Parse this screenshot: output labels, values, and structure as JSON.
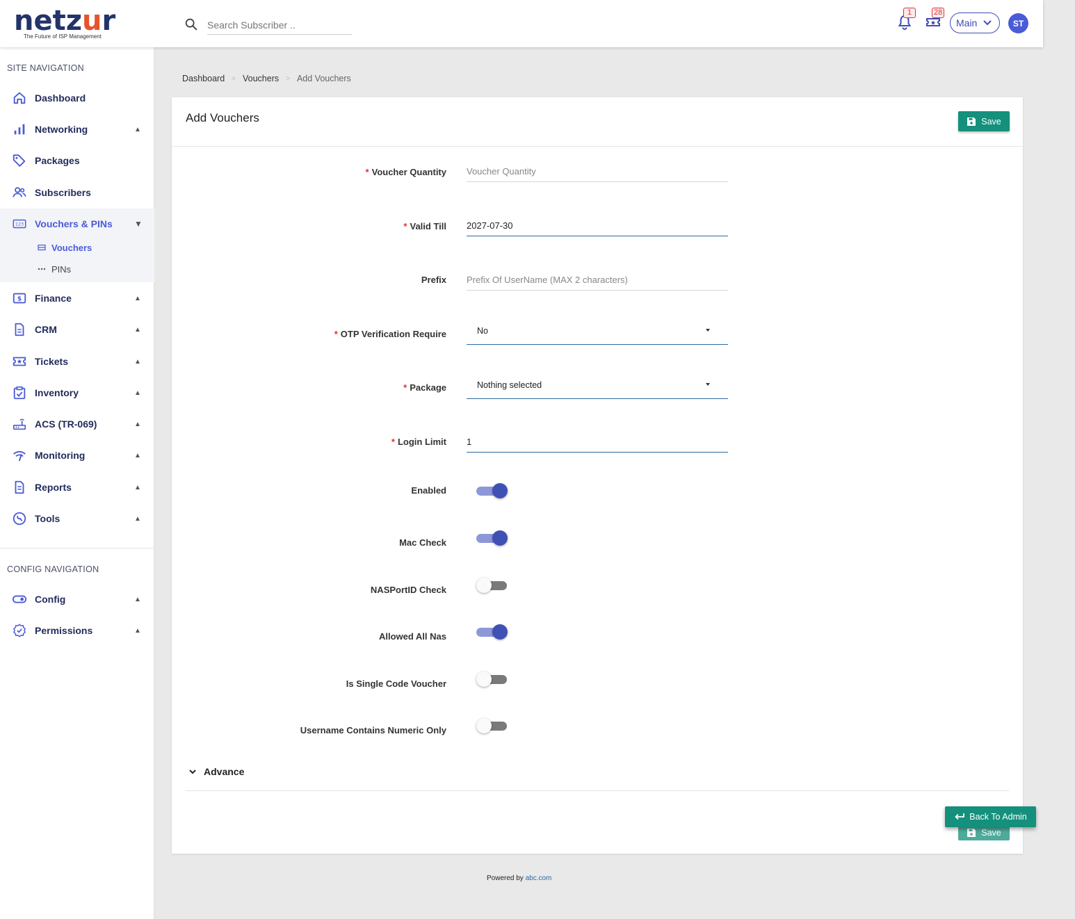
{
  "header": {
    "logo_text": "netzur",
    "logo_tagline": "The Future of ISP Management",
    "search_placeholder": "Search Subscriber ..",
    "notifications_count": "1",
    "tickets_count": "28",
    "branch_label": "Main",
    "avatar_initials": "ST"
  },
  "sidebar": {
    "site_heading": "SITE NAVIGATION",
    "items": [
      {
        "label": "Dashboard"
      },
      {
        "label": "Networking"
      },
      {
        "label": "Packages"
      },
      {
        "label": "Subscribers"
      },
      {
        "label": "Vouchers & PINs"
      },
      {
        "label": "Finance"
      },
      {
        "label": "CRM"
      },
      {
        "label": "Tickets"
      },
      {
        "label": "Inventory"
      },
      {
        "label": "ACS (TR-069)"
      },
      {
        "label": "Monitoring"
      },
      {
        "label": "Reports"
      },
      {
        "label": "Tools"
      }
    ],
    "sub_items": [
      {
        "label": "Vouchers"
      },
      {
        "label": "PINs"
      }
    ],
    "config_heading": "CONFIG NAVIGATION",
    "config_items": [
      {
        "label": "Config"
      },
      {
        "label": "Permissions"
      }
    ]
  },
  "breadcrumb": {
    "items": [
      "Dashboard",
      "Vouchers",
      "Add Vouchers"
    ]
  },
  "form": {
    "title": "Add Vouchers",
    "save_label": "Save",
    "voucher_quantity": {
      "label": "Voucher Quantity",
      "placeholder": "Voucher Quantity",
      "value": ""
    },
    "valid_till": {
      "label": "Valid Till",
      "value": "2027-07-30"
    },
    "prefix": {
      "label": "Prefix",
      "placeholder": "Prefix Of UserName (MAX 2 characters)"
    },
    "otp": {
      "label": "OTP Verification Require",
      "value": "No"
    },
    "package": {
      "label": "Package",
      "value": "Nothing selected"
    },
    "login_limit": {
      "label": "Login Limit",
      "value": "1"
    },
    "toggles": [
      {
        "label": "Enabled",
        "on": true
      },
      {
        "label": "Mac Check",
        "on": true
      },
      {
        "label": "NASPortID Check",
        "on": false
      },
      {
        "label": "Allowed All Nas",
        "on": true
      },
      {
        "label": "Is Single Code Voucher",
        "on": false
      },
      {
        "label": "Username Contains Numeric Only",
        "on": false
      }
    ],
    "advance_label": "Advance",
    "back_label": "Back To Admin"
  },
  "footer": {
    "text": "Powered by",
    "link": "abc.com"
  }
}
